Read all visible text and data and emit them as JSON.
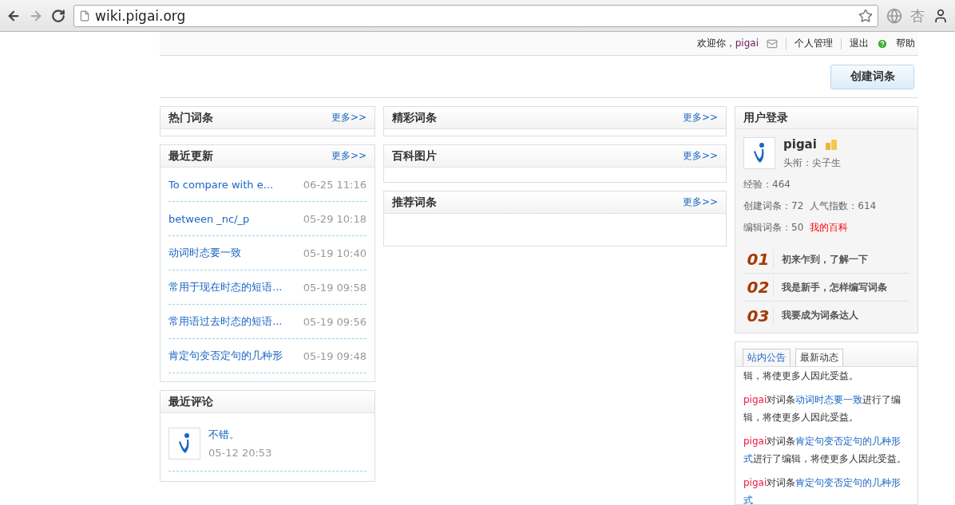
{
  "browser": {
    "url": "wiki.pigai.org",
    "extension_glyph": "杏"
  },
  "topbar": {
    "welcome": "欢迎你，",
    "username": "pigai",
    "links": [
      "个人管理",
      "退出",
      "帮助"
    ]
  },
  "create_button": "创建词条",
  "left": [
    {
      "title": "热门词条",
      "more": "更多>>",
      "kind": "empty"
    },
    {
      "title": "最近更新",
      "more": "更多>>",
      "kind": "list",
      "items": [
        {
          "title": "To compare with e...",
          "time": "06-25 11:16"
        },
        {
          "title": "between _nc/_p",
          "time": "05-29 10:18"
        },
        {
          "title": "动词时态要一致",
          "time": "05-19 10:40"
        },
        {
          "title": "常用于现在时态的短语...",
          "time": "05-19 09:58"
        },
        {
          "title": "常用语过去时态的短语...",
          "time": "05-19 09:56"
        },
        {
          "title": "肯定句变否定句的几种形",
          "time": "05-19 09:48"
        }
      ]
    },
    {
      "title": "最近评论",
      "kind": "comments",
      "items": [
        {
          "text": "不错。",
          "time": "05-12 20:53"
        }
      ]
    }
  ],
  "middle": [
    {
      "title": "精彩词条",
      "more": "更多>>",
      "kind": "empty"
    },
    {
      "title": "百科图片",
      "more": "更多>>",
      "kind": "short"
    },
    {
      "title": "推荐词条",
      "more": "更多>>",
      "kind": "tall"
    }
  ],
  "login": {
    "title": "用户登录",
    "name": "pigai",
    "rank_label": "头衔：",
    "rank": "尖子生",
    "stats": [
      [
        {
          "label": "经验：",
          "value": "464"
        }
      ],
      [
        {
          "label": "创建词条：",
          "value": "72"
        },
        {
          "label": "人气指数：",
          "value": "614"
        }
      ],
      [
        {
          "label": "编辑词条：",
          "value": "50"
        }
      ]
    ],
    "my_link": "我的百科",
    "guides": [
      {
        "num": "01",
        "text": "初来乍到，了解一下"
      },
      {
        "num": "02",
        "text": "我是新手，怎样编写词条"
      },
      {
        "num": "03",
        "text": "我要成为词条达人"
      }
    ]
  },
  "news": {
    "tabs": [
      {
        "label": "站内公告",
        "selected": false
      },
      {
        "label": "最新动态",
        "selected": true
      }
    ],
    "items": [
      [
        {
          "kind": "text",
          "text": "辑，将使更多人因此受益。"
        }
      ],
      [
        {
          "kind": "user",
          "text": "pigai"
        },
        {
          "kind": "text",
          "text": "对词条"
        },
        {
          "kind": "link",
          "text": "动词时态要一致"
        },
        {
          "kind": "text",
          "text": "进行了编辑，将使更多人因此受益。"
        }
      ],
      [
        {
          "kind": "user",
          "text": "pigai"
        },
        {
          "kind": "text",
          "text": "对词条"
        },
        {
          "kind": "link",
          "text": "肯定句变否定句的几种形式"
        },
        {
          "kind": "text",
          "text": "进行了编辑，将使更多人因此受益。"
        }
      ],
      [
        {
          "kind": "user",
          "text": "pigai"
        },
        {
          "kind": "text",
          "text": "对词条"
        },
        {
          "kind": "link",
          "text": "肯定句变否定句的几种形式"
        }
      ]
    ]
  }
}
